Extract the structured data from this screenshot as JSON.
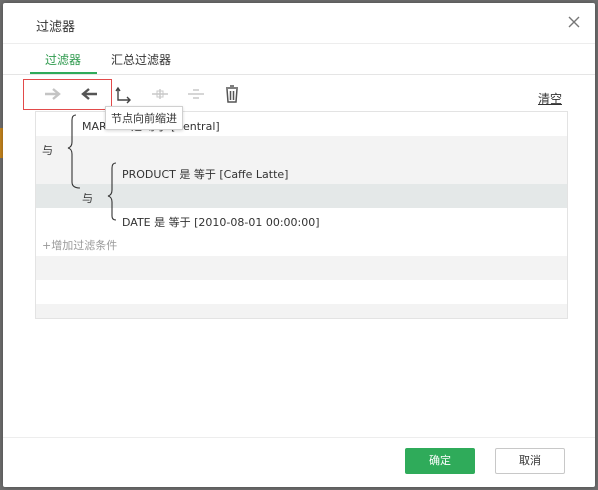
{
  "dialog": {
    "title": "过滤器"
  },
  "tabs": [
    {
      "label": "过滤器",
      "active": true
    },
    {
      "label": "汇总过滤器",
      "active": false
    }
  ],
  "toolbar": {
    "tooltip": "节点向前缩进",
    "clear_label": "清空",
    "buttons": [
      "arrow-right-icon",
      "arrow-left-icon",
      "indent-corner-icon",
      "add-node-icon",
      "remove-node-icon",
      "trash-icon"
    ]
  },
  "tree": {
    "root_logic": "与",
    "nested_logic": "与",
    "conditions": [
      "MARKET 是 等于 [Central]",
      "PRODUCT 是 等于 [Caffe Latte]",
      "DATE 是 等于 [2010-08-01 00:00:00]"
    ],
    "add_condition": "+增加过滤条件"
  },
  "footer": {
    "ok_label": "确定",
    "cancel_label": "取消"
  },
  "colors": {
    "accent": "#2fab5a",
    "highlight": "#e24a4a"
  }
}
